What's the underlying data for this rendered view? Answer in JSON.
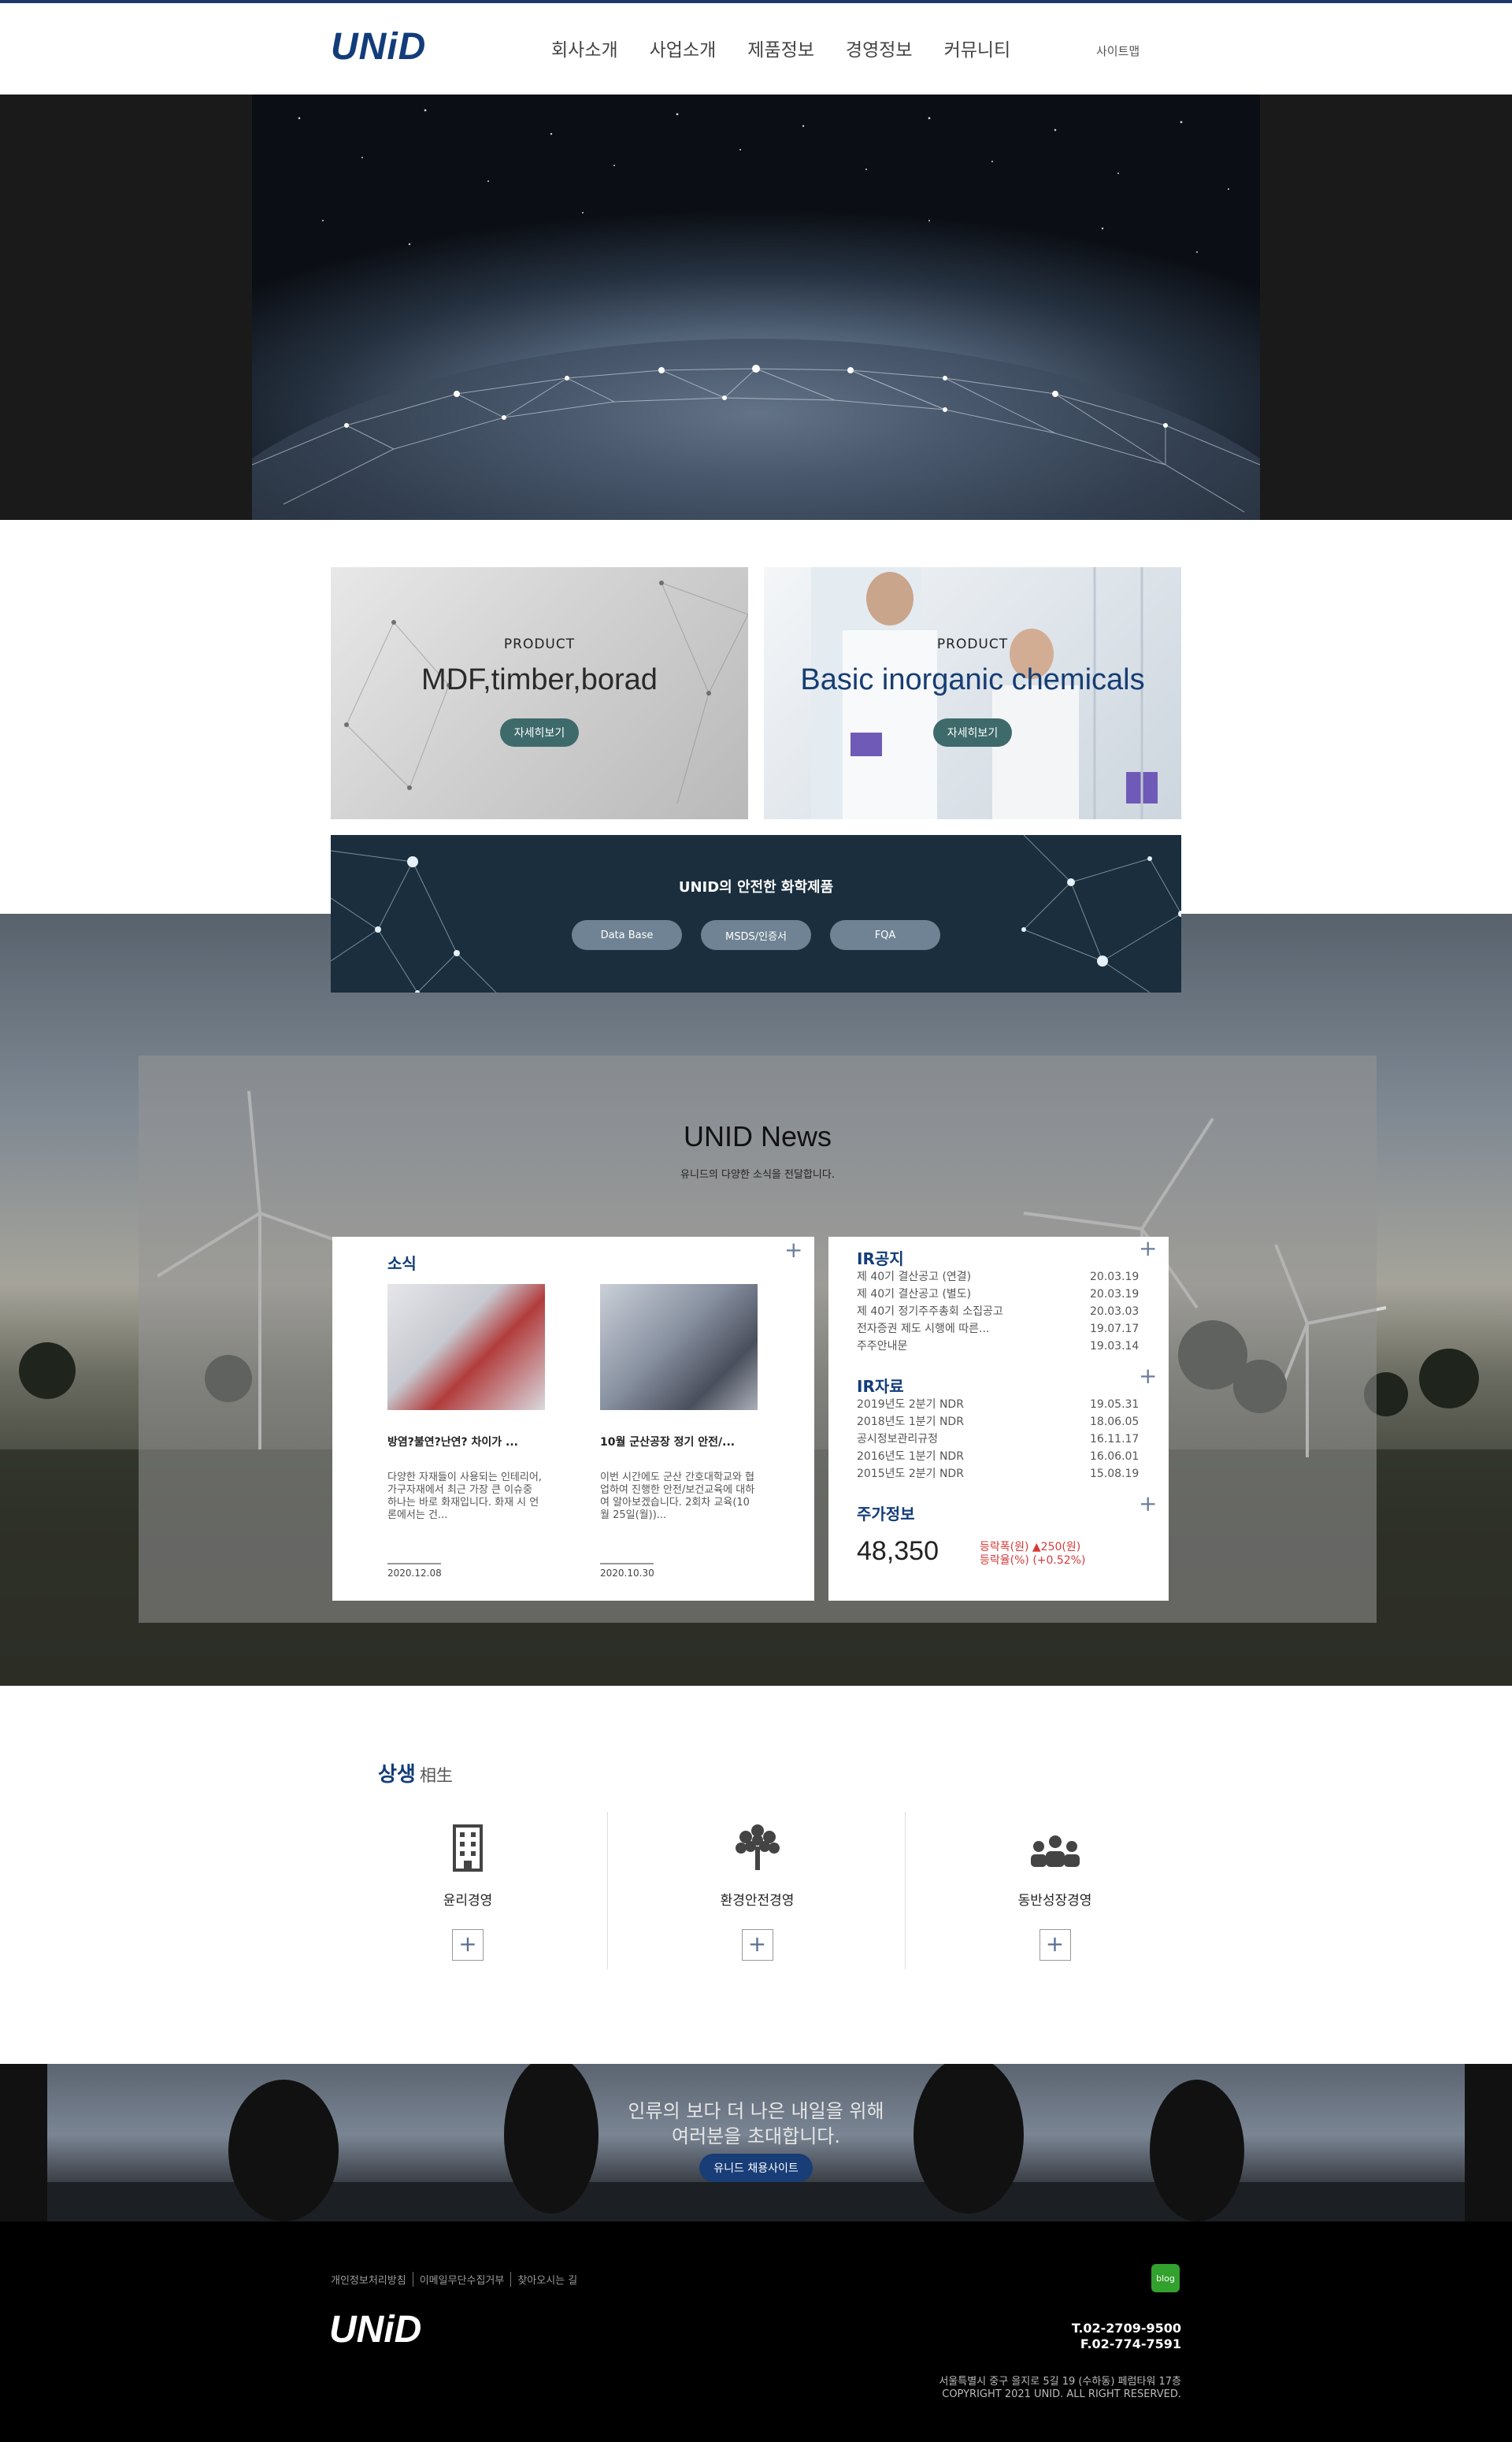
{
  "header": {
    "logo": "UNiD",
    "nav": [
      "회사소개",
      "사업소개",
      "제품정보",
      "경영정보",
      "커뮤니티"
    ],
    "sitemap": "사이트맵"
  },
  "products": [
    {
      "sub": "PRODUCT",
      "title": "MDF,timber,borad",
      "button": "자세히보기"
    },
    {
      "sub": "PRODUCT",
      "title": "Basic inorganic chemicals",
      "button": "자세히보기"
    }
  ],
  "chem_banner": {
    "title": "UNID의 안전한 화학제품",
    "buttons": [
      "Data Base",
      "MSDS/인증서",
      "FQA"
    ]
  },
  "news": {
    "title": "UNID News",
    "subtitle": "유니드의 다양한 소식을 전달합니다.",
    "box_title": "소식",
    "plus": "+",
    "items": [
      {
        "headline": "방염?불연?난연? 차이가 ...",
        "desc": "다양한 자재들이 사용되는 인테리어, 가구자재에서 최근 가장 큰 이슈중 하나는 바로 화재입니다. 화재 시 언론에서는 건...",
        "date": "2020.12.08"
      },
      {
        "headline": "10월 군산공장 정기 안전/...",
        "desc": "이번 시간에도 군산 간호대학교와 협업하여 진행한 안전/보건교육에 대하여 알아보겠습니다. 2회차 교육(10월 25일(월))...",
        "date": "2020.10.30"
      }
    ]
  },
  "ir": {
    "notice_title": "IR공지",
    "notice": [
      {
        "title": "제 40기 결산공고 (연결)",
        "date": "20.03.19"
      },
      {
        "title": "제 40기 결산공고 (별도)",
        "date": "20.03.19"
      },
      {
        "title": "제 40기 정기주주총회 소집공고",
        "date": "20.03.03"
      },
      {
        "title": "전자증권 제도 시행에 따른...",
        "date": "19.07.17"
      },
      {
        "title": "주주안내문",
        "date": "19.03.14"
      }
    ],
    "data_title": "IR자료",
    "data": [
      {
        "title": "2019년도 2분기 NDR",
        "date": "19.05.31"
      },
      {
        "title": "2018년도 1분기 NDR",
        "date": "18.06.05"
      },
      {
        "title": "공시정보관리규정",
        "date": "16.11.17"
      },
      {
        "title": "2016년도 1분기 NDR",
        "date": "16.06.01"
      },
      {
        "title": "2015년도 2분기 NDR",
        "date": "15.08.19"
      }
    ],
    "stock_title": "주가정보",
    "stock_price": "48,350",
    "stock_change_won": "등락폭(원) ▲250(원)",
    "stock_change_pct": "등락율(%) (+0.52%)",
    "plus": "+"
  },
  "sangsaeng": {
    "title": "상생",
    "hanja": "相生",
    "items": [
      {
        "label": "윤리경영",
        "icon": "building-icon"
      },
      {
        "label": "환경안전경영",
        "icon": "tree-icon"
      },
      {
        "label": "동반성장경영",
        "icon": "people-icon"
      }
    ],
    "plus": "+"
  },
  "recruit": {
    "line1": "인류의 보다 더 나은 내일을 위해",
    "line2": "여러분을 초대합니다.",
    "button": "유니드 채용사이트"
  },
  "footer": {
    "links": [
      "개인정보처리방침",
      "이메일무단수집거부",
      "찾아오시는 길"
    ],
    "logo": "UNiD",
    "blog": "blog",
    "tel": "T.02-2709-9500",
    "fax": "F.02-774-7591",
    "address": "서울특별시 중구 을지로 5길 19 (수하동) 페럼타워 17층",
    "copyright": "COPYRIGHT 2021 UNID. ALL RIGHT RESERVED."
  },
  "colors": {
    "brand": "#123c7a",
    "button_teal": "#3e6a6b",
    "banner": "#1a2e3d",
    "stock_up": "#d63a3a"
  }
}
